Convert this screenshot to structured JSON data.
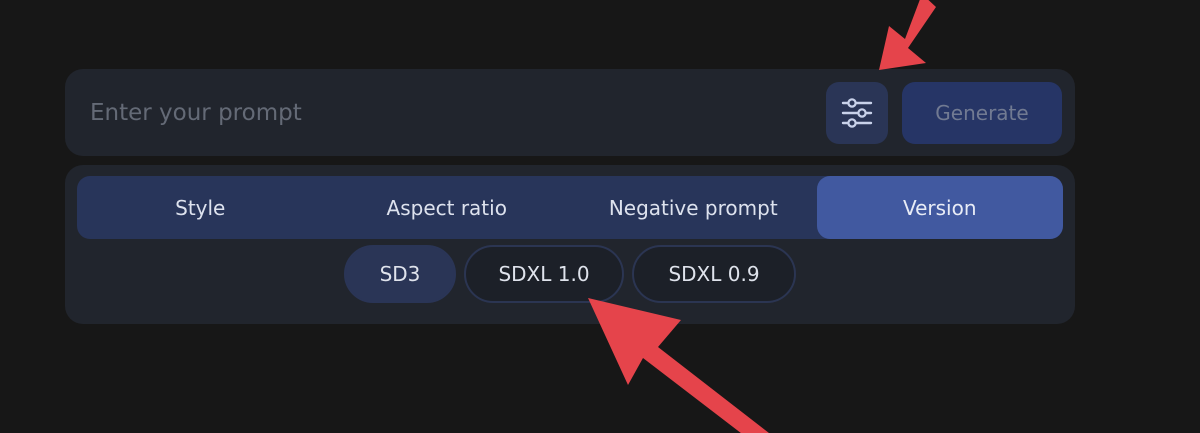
{
  "prompt": {
    "placeholder": "Enter your prompt",
    "value": ""
  },
  "toolbar": {
    "settings_icon": "sliders-icon",
    "generate_label": "Generate"
  },
  "tabs": [
    {
      "label": "Style",
      "active": false
    },
    {
      "label": "Aspect ratio",
      "active": false
    },
    {
      "label": "Negative prompt",
      "active": false
    },
    {
      "label": "Version",
      "active": true
    }
  ],
  "versions": [
    {
      "label": "SD3",
      "selected": true
    },
    {
      "label": "SDXL 1.0",
      "selected": false
    },
    {
      "label": "SDXL 0.9",
      "selected": false
    }
  ],
  "colors": {
    "background": "#171717",
    "panel": "#21252d",
    "accent": "#4159a0",
    "annotation_arrow": "#e5444b"
  },
  "annotations": [
    {
      "icon": "arrow-icon",
      "points_to": "settings-button"
    },
    {
      "icon": "arrow-icon",
      "points_to": "version-chip-sdxl-1-0"
    }
  ]
}
